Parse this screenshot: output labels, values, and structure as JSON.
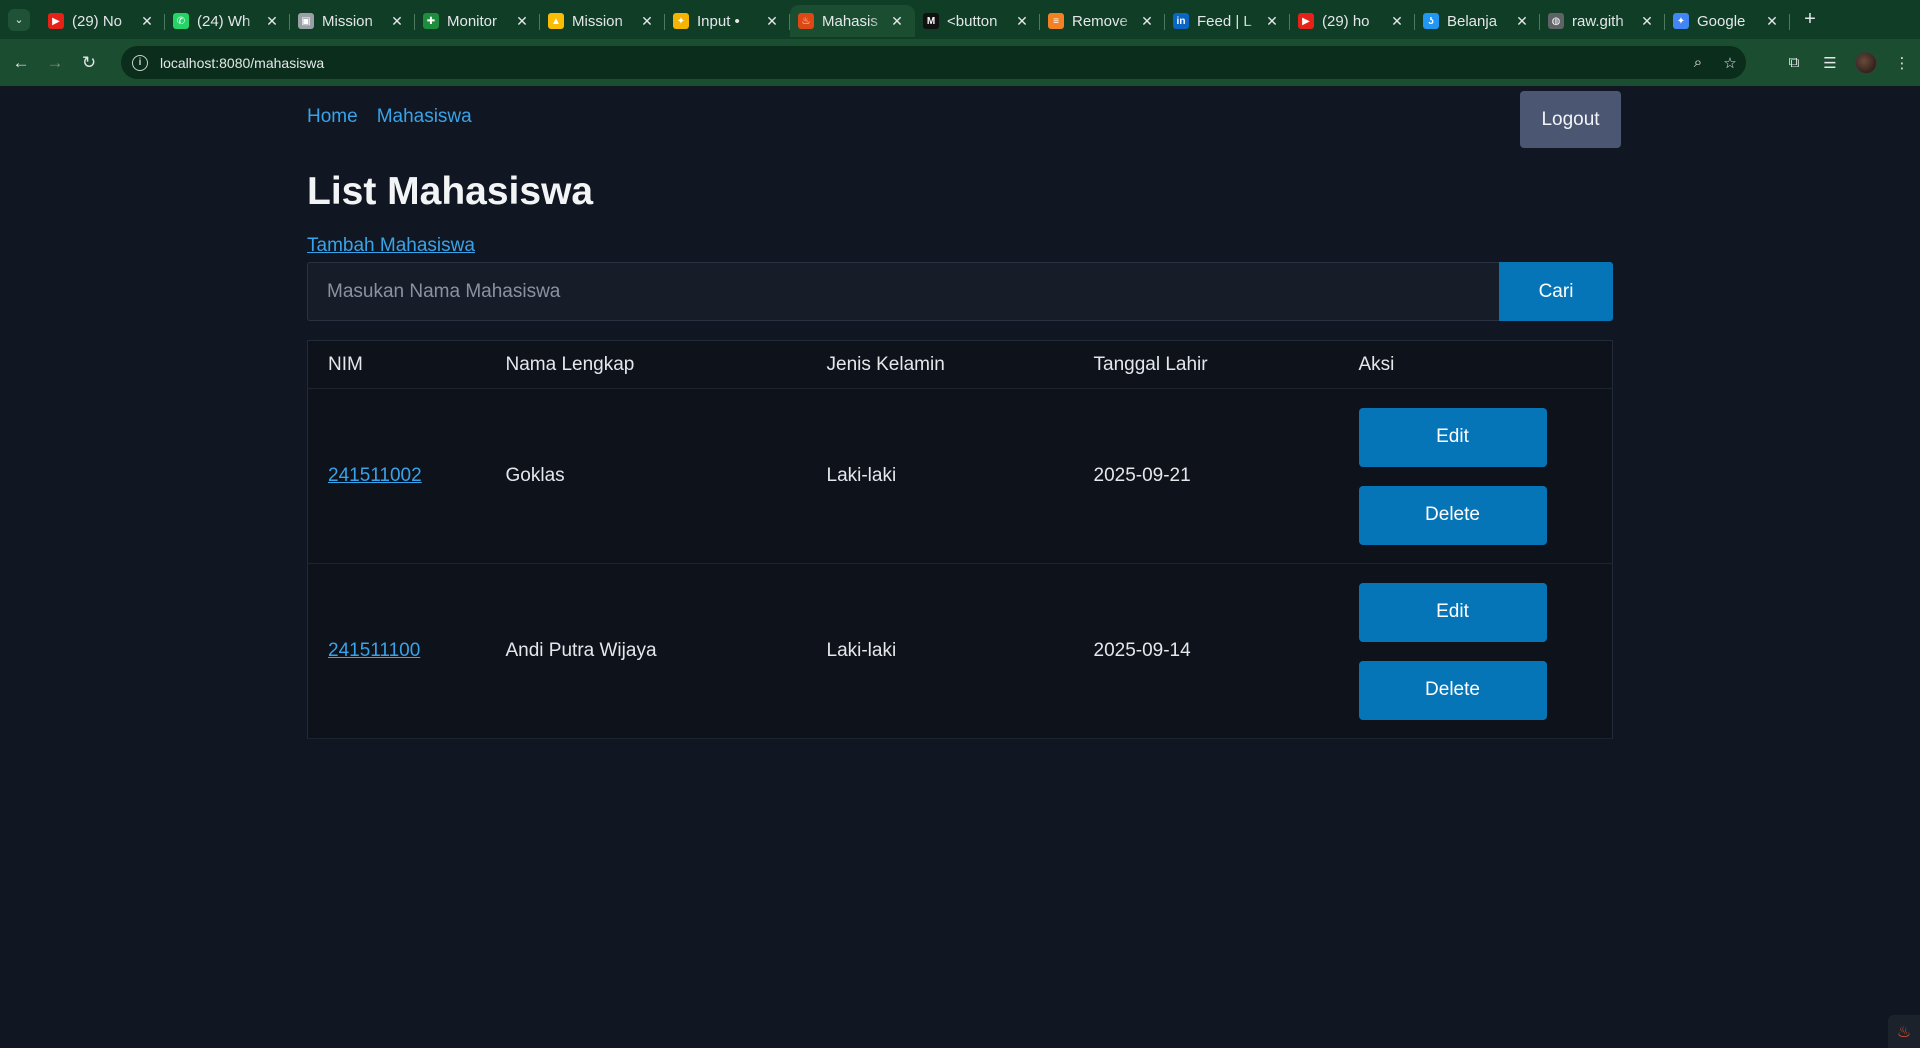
{
  "browser": {
    "tabs": [
      {
        "title": "(29) No",
        "icon": "youtube-icon",
        "color": "#e62117",
        "glyph": "▶"
      },
      {
        "title": "(24) Wh",
        "icon": "whatsapp-icon",
        "color": "#25d366",
        "glyph": "✆"
      },
      {
        "title": "Mission",
        "icon": "image-icon",
        "color": "#9aa0a6",
        "glyph": "▣"
      },
      {
        "title": "Monitor",
        "icon": "sheets-icon",
        "color": "#1e8e3e",
        "glyph": "✚"
      },
      {
        "title": "Mission",
        "icon": "drive-icon",
        "color": "#fbbc04",
        "glyph": "▲"
      },
      {
        "title": "Input • ",
        "icon": "sparkle-icon",
        "color": "#f4b400",
        "glyph": "✦"
      },
      {
        "title": "Mahasis",
        "icon": "codeigniter-icon",
        "color": "#dd4814",
        "glyph": "♨",
        "active": true
      },
      {
        "title": "<button",
        "icon": "medium-icon",
        "color": "#111111",
        "glyph": "M"
      },
      {
        "title": "Remove",
        "icon": "stackoverflow-icon",
        "color": "#f48024",
        "glyph": "≡"
      },
      {
        "title": "Feed | L",
        "icon": "linkedin-icon",
        "color": "#0a66c2",
        "glyph": "in"
      },
      {
        "title": "(29) ho",
        "icon": "youtube-icon",
        "color": "#e62117",
        "glyph": "▶"
      },
      {
        "title": "Belanja",
        "icon": "shop-icon",
        "color": "#2196f3",
        "glyph": "ʖ"
      },
      {
        "title": "raw.gith",
        "icon": "globe-icon",
        "color": "#5f6368",
        "glyph": "◍"
      },
      {
        "title": "Google",
        "icon": "gemini-icon",
        "color": "#4285f4",
        "glyph": "✦"
      }
    ],
    "url": "localhost:8080/mahasiswa"
  },
  "nav": {
    "home": "Home",
    "mahasiswa": "Mahasiswa",
    "logout": "Logout"
  },
  "page": {
    "title": "List Mahasiswa",
    "add_link": "Tambah Mahasiswa",
    "search_placeholder": "Masukan Nama Mahasiswa",
    "search_button": "Cari"
  },
  "table": {
    "headers": [
      "NIM",
      "Nama Lengkap",
      "Jenis Kelamin",
      "Tanggal Lahir",
      "Aksi"
    ],
    "rows": [
      {
        "nim": "241511002",
        "nama": "Goklas",
        "jk": "Laki-laki",
        "tgl": "2025-09-21",
        "edit": "Edit",
        "delete": "Delete"
      },
      {
        "nim": "241511100",
        "nama": "Andi Putra Wijaya",
        "jk": "Laki-laki",
        "tgl": "2025-09-14",
        "edit": "Edit",
        "delete": "Delete"
      }
    ]
  },
  "colors": {
    "accent": "#0575b8",
    "link": "#38a3e8",
    "background": "#111722"
  }
}
